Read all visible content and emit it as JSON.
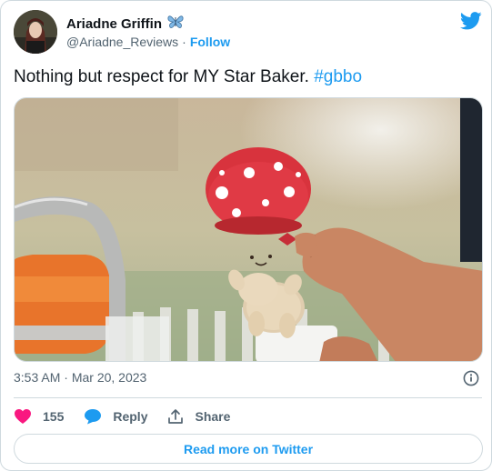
{
  "author": {
    "display_name": "Ariadne Griffin",
    "badge_icon": "butterfly-icon",
    "handle": "@Ariadne_Reviews",
    "separator": "·",
    "follow_label": "Follow"
  },
  "tweet": {
    "text": "Nothing but respect for MY Star Baker.",
    "hashtag": "#gbbo",
    "media_alt": "Mushroom plush toy held in a hand"
  },
  "meta": {
    "time": "3:53 AM",
    "separator": "·",
    "date": "Mar 20, 2023"
  },
  "actions": {
    "likes": "155",
    "reply_label": "Reply",
    "share_label": "Share"
  },
  "footer": {
    "read_more_label": "Read more on Twitter"
  },
  "colors": {
    "accent": "#1d9bf0",
    "like": "#f91880",
    "text_secondary": "#536471",
    "border": "#cfd9de"
  }
}
